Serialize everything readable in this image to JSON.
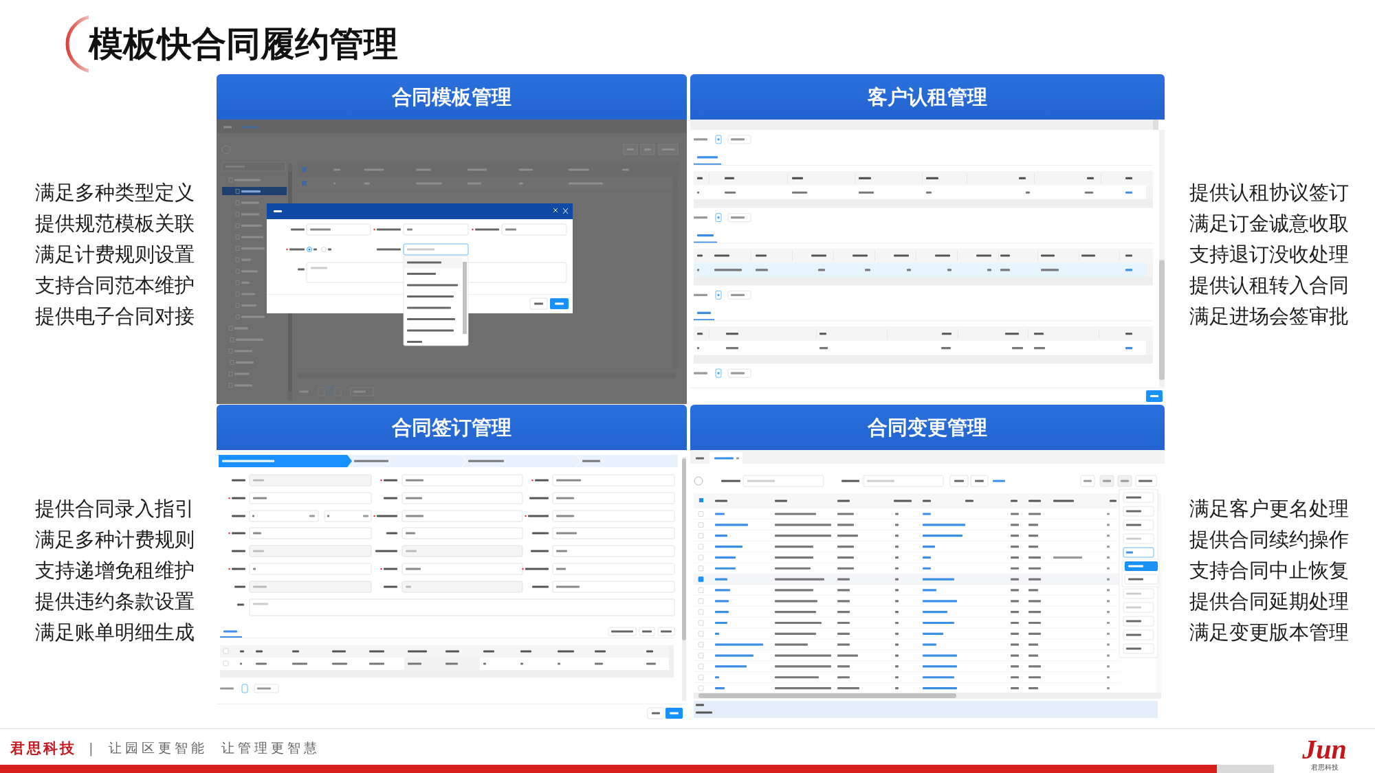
{
  "title": "模板快合同履约管理",
  "features": {
    "left_top": [
      "满足多种类型定义",
      "提供规范模板关联",
      "满足计费规则设置",
      "支持合同范本维护",
      "提供电子合同对接"
    ],
    "left_bottom": [
      "提供合同录入指引",
      "满足多种计费规则",
      "支持递增免租维护",
      "提供违约条款设置",
      "满足账单明细生成"
    ],
    "right_top": [
      "提供认租协议签订",
      "满足订金诚意收取",
      "支持退订没收处理",
      "提供认租转入合同",
      "满足进场会签审批"
    ],
    "right_bottom": [
      "满足客户更名处理",
      "提供合同续约操作",
      "支持合同中止恢复",
      "提供合同延期处理",
      "满足变更版本管理"
    ]
  },
  "panels": [
    {
      "title": "合同模板管理",
      "kind": "dialog"
    },
    {
      "title": "客户认租管理",
      "kind": "tables"
    },
    {
      "title": "合同签订管理",
      "kind": "form"
    },
    {
      "title": "合同变更管理",
      "kind": "list"
    }
  ],
  "footer": {
    "brand": "君思科技",
    "separator": "|",
    "slogan": [
      "让园区更智能",
      "让管理更智慧"
    ]
  },
  "logo": {
    "mark": "Jun",
    "caption": "君思科技"
  }
}
